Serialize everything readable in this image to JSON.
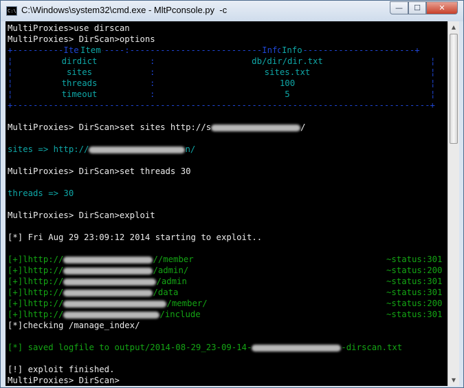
{
  "window": {
    "title": "C:\\Windows\\system32\\cmd.exe - MltPconsole.py  -c",
    "icon": "C:\\"
  },
  "controls": {
    "minimize": "—",
    "maximize": "☐",
    "close": "✕"
  },
  "console": {
    "cmd_use": "MultiProxies>use dirscan",
    "cmd_options": "MultiProxies> DirScan>options",
    "table_top": "+----------Item--------:--------------------------Info--------------------------+",
    "table_bottom": "+----------------------------------------------------------------------------------+",
    "headers": {
      "item": "Item",
      "info": "Info"
    },
    "options": [
      {
        "item": "dirdict",
        "info": "db/dir/dir.txt"
      },
      {
        "item": "sites",
        "info": "sites.txt"
      },
      {
        "item": "threads",
        "info": "100"
      },
      {
        "item": "timeout",
        "info": "5"
      }
    ],
    "cmd_set_sites_prefix": "MultiProxies> DirScan>set sites http://s",
    "cmd_set_sites_suffix": "/",
    "resp_sites_prefix": "sites => http://",
    "resp_sites_suffix": "n/",
    "cmd_set_threads": "MultiProxies> DirScan>set threads 30",
    "resp_threads": "threads => 30",
    "cmd_exploit": "MultiProxies> DirScan>exploit",
    "start_msg": "[*] Fri Aug 29 23:09:12 2014 starting to exploit..",
    "results": [
      {
        "prefix": "[+]lhttp://",
        "path": "//member",
        "status": "~status:301"
      },
      {
        "prefix": "[+]lhttp://",
        "path": "/admin/",
        "status": "~status:200"
      },
      {
        "prefix": "[+]lhttp://",
        "path": "/admin",
        "status": "~status:301"
      },
      {
        "prefix": "[+]lhttp://",
        "path": "/data",
        "status": "~status:301"
      },
      {
        "prefix": "[+]lhttp://",
        "path": "/member/",
        "status": "~status:200"
      },
      {
        "prefix": "[+]lhttp://",
        "path": "/include",
        "status": "~status:301"
      }
    ],
    "checking": "[*]checking /manage_index/",
    "saved_prefix": "[*] saved logfile to output/2014-08-29_23-09-14-",
    "saved_suffix": "-dirscan.txt",
    "finished": "[!] exploit finished.",
    "prompt_end": "MultiProxies> DirScan>"
  }
}
